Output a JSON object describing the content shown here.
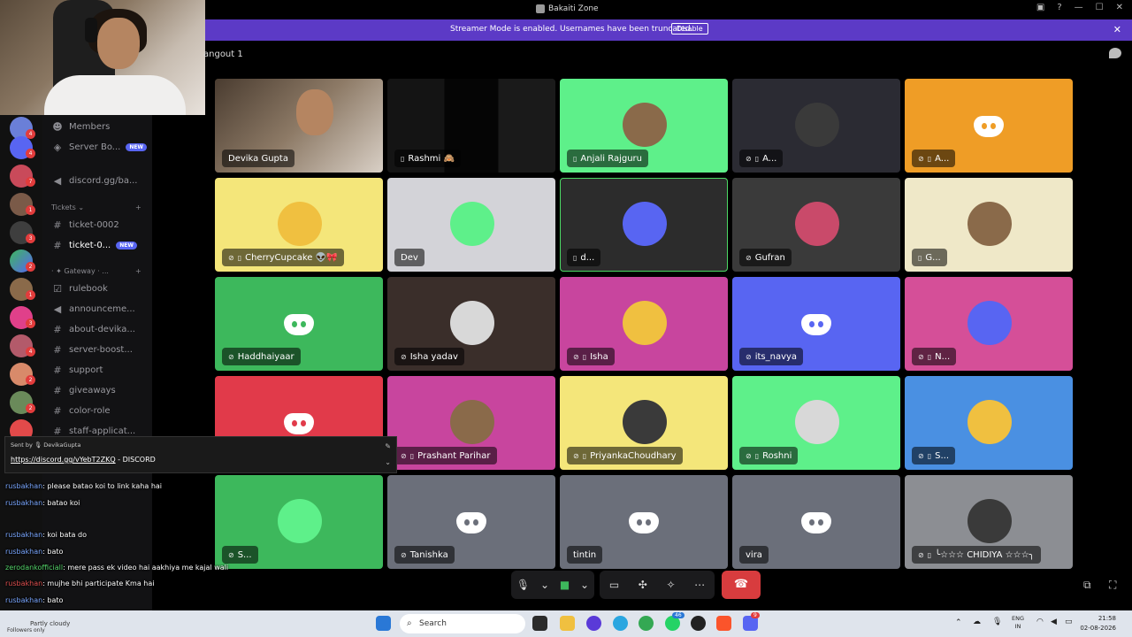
{
  "window": {
    "title": "Bakaiti Zone"
  },
  "banner": {
    "text": "Streamer Mode is enabled. Usernames have been truncated.",
    "disable_label": "Disable"
  },
  "header": {
    "channel_name": "angout 1"
  },
  "sidebar": {
    "items": [
      {
        "label": "Members",
        "icon": "people-icon"
      },
      {
        "label": "Server Bo...",
        "icon": "shield-icon",
        "badge": "NEW"
      },
      {
        "label": "discord.gg/ba...",
        "icon": "megaphone-icon"
      }
    ],
    "category_tickets": "Tickets",
    "tickets": [
      {
        "label": "ticket-0002"
      },
      {
        "label": "ticket-0...",
        "badge": "NEW"
      }
    ],
    "category_gateway": "· ✦ Gateway · ...",
    "channels": [
      {
        "label": "rulebook",
        "icon": "checklist-icon"
      },
      {
        "label": "announceme...",
        "icon": "megaphone-icon"
      },
      {
        "label": "about-devika...",
        "icon": "hash-icon"
      },
      {
        "label": "server-boost...",
        "icon": "hash-icon"
      },
      {
        "label": "support",
        "icon": "hash-icon"
      },
      {
        "label": "giveaways",
        "icon": "hash-icon"
      },
      {
        "label": "color-role",
        "icon": "hash-icon"
      },
      {
        "label": "staff-applicat...",
        "icon": "hash-icon"
      }
    ],
    "server_badges": [
      "4",
      "4",
      "7",
      "1",
      "3",
      "2",
      "1",
      "3",
      "4",
      "2",
      "2"
    ]
  },
  "tiles": [
    {
      "name": "Devika Gupta",
      "bg": "#3a2f27",
      "kind": "video"
    },
    {
      "name": "Rashmi 🙈",
      "bg": "#111111",
      "kind": "video-dark",
      "mic": true
    },
    {
      "name": "Anjali Rajguru",
      "bg": "#5ef08a",
      "kind": "avatar",
      "mic": true
    },
    {
      "name": "A...",
      "bg": "#2b2b33",
      "kind": "avatar-photo",
      "mic": true,
      "muted": true
    },
    {
      "name": "A...",
      "bg": "#ef9d26",
      "kind": "discord",
      "mic": true,
      "muted": true
    },
    {
      "name": "CherryCupcake 👽🎀",
      "bg": "#f4e67a",
      "kind": "avatar",
      "mic": true,
      "muted": true
    },
    {
      "name": "Dev",
      "bg": "#d3d3d8",
      "kind": "avatar-photo"
    },
    {
      "name": "d...",
      "bg": "#2c2c2c",
      "kind": "avatar-photo",
      "mic": true,
      "selected": true
    },
    {
      "name": "Gufran",
      "bg": "#3a3a3a",
      "kind": "avatar-photo",
      "muted": true
    },
    {
      "name": "G...",
      "bg": "#efe8c8",
      "kind": "avatar-photo",
      "mic": true
    },
    {
      "name": "Haddhaiyaar",
      "bg": "#3db85c",
      "kind": "discord",
      "muted": true
    },
    {
      "name": "Isha yadav",
      "bg": "#3a2e2a",
      "kind": "avatar-photo",
      "muted": true
    },
    {
      "name": "Isha",
      "bg": "#c8459e",
      "kind": "avatar",
      "mic": true,
      "muted": true
    },
    {
      "name": "its_navya",
      "bg": "#5865f2",
      "kind": "discord",
      "muted": true
    },
    {
      "name": "N...",
      "bg": "#d54f98",
      "kind": "avatar-photo",
      "mic": true,
      "muted": true
    },
    {
      "name": "",
      "bg": "#e13a4a",
      "kind": "discord"
    },
    {
      "name": "Prashant Parihar",
      "bg": "#c8459e",
      "kind": "avatar",
      "mic": true,
      "muted": true
    },
    {
      "name": "PriyankaChoudhary",
      "bg": "#f4e67a",
      "kind": "avatar",
      "mic": true,
      "muted": true
    },
    {
      "name": "Roshni",
      "bg": "#5ef08a",
      "kind": "avatar",
      "mic": true,
      "muted": true
    },
    {
      "name": "S...",
      "bg": "#4a90e2",
      "kind": "avatar",
      "mic": true,
      "muted": true
    },
    {
      "name": "S...",
      "bg": "#3db85c",
      "kind": "avatar",
      "muted": true
    },
    {
      "name": "Tanishka",
      "bg": "#6b6f7a",
      "kind": "discord",
      "muted": true
    },
    {
      "name": "tintin",
      "bg": "#6b6f7a",
      "kind": "discord"
    },
    {
      "name": "vira",
      "bg": "#6b6f7a",
      "kind": "discord"
    },
    {
      "name": "╰☆☆☆ CHIDIYA ☆☆☆╮",
      "bg": "#8c8e93",
      "kind": "avatar-photo",
      "mic": true,
      "muted": true
    }
  ],
  "chat_popup": {
    "sent_by": "Sent by 🎙 DevikaGupta",
    "link": "https://discord.gg/vYebT2ZKQ",
    "suffix": " - DISCORD"
  },
  "chat_lines": [
    {
      "user": "rusbakhan",
      "text": ": please batao koi to link kaha hai"
    },
    {
      "user": "rusbakhan",
      "text": ": batao koi"
    },
    {
      "user": "rusbakhan",
      "text": ": koi bata do"
    },
    {
      "user": "rusbakhan",
      "text": ": bato"
    },
    {
      "user": "zerodankofficiall",
      "text": ": mere pass ek video hai aakhiya me kajal wali"
    },
    {
      "user": "rusbakhan",
      "text": ": mujhe bhi participate Kma hai"
    },
    {
      "user": "rusbakhan",
      "text": ": bato"
    }
  ],
  "weather": {
    "line1": "Partly cloudy",
    "line2": "Followers only"
  },
  "taskbar": {
    "search_placeholder": "Search",
    "lang": "ENG",
    "region": "IN",
    "time": "21:58",
    "date": "02-08-2026",
    "badge1": "46",
    "badge2": "9"
  }
}
